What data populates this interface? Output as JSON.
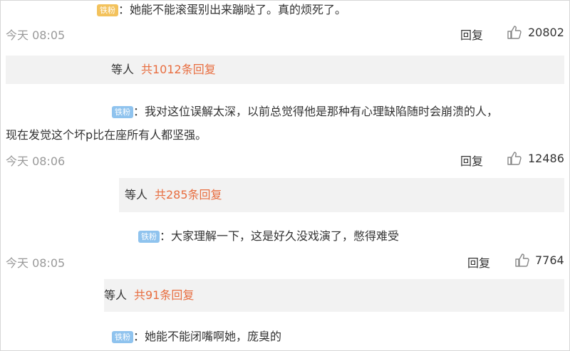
{
  "comments": [
    {
      "badge": "铁粉",
      "text": "：她能不能滚蛋别出来蹦哒了。真的烦死了。",
      "time": "今天 08:05",
      "reply_label": "回复",
      "likes": "20802",
      "thread": {
        "prefix": "等人",
        "replies": "共1012条回复"
      }
    },
    {
      "badge": "铁粉",
      "text_line1": "：我对这位误解太深，以前总觉得他是那种有心理缺陷随时会崩溃的人，",
      "text_line2": "现在发觉这个坏p比在座所有人都坚强。",
      "time": "今天 08:06",
      "reply_label": "回复",
      "likes": "12486",
      "thread": {
        "prefix": "等人",
        "replies": "共285条回复"
      }
    },
    {
      "badge": "铁粉",
      "text": "：大家理解一下，这是好久没戏演了，憋得难受",
      "time": "今天 08:05",
      "reply_label": "回复",
      "likes": "7764",
      "thread": {
        "prefix": "等人",
        "replies": "共91条回复"
      }
    },
    {
      "badge": "铁粉",
      "text": "：她能不能闭嘴啊她，庞臭的"
    }
  ],
  "colors": {
    "accent": "#e86d3f",
    "badge": "#8fc3ee",
    "bar": "#f2f2f2",
    "time": "#999999"
  }
}
